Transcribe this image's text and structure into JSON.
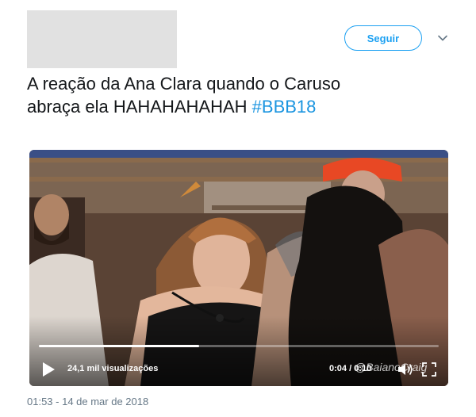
{
  "header": {
    "follow_label": "Seguir"
  },
  "tweet": {
    "line1": "A reação da Ana Clara quando o Caruso",
    "line2_text": "abraça ela HAHAHAHAHAH ",
    "hashtag": "#BBB18"
  },
  "video": {
    "views_label": "24,1 mil visualizações",
    "time_label": "0:04 / 0:10",
    "watermark": "@BaianoCraig",
    "progress": 0.4
  },
  "footer": {
    "timestamp": "01:53 - 14 de mar de 2018"
  },
  "colors": {
    "accent": "#1da1f2",
    "hashtag": "#1b95e0",
    "muted": "#657786"
  },
  "icons": [
    "chevron-down-icon",
    "play-icon",
    "volume-icon",
    "fullscreen-icon"
  ]
}
